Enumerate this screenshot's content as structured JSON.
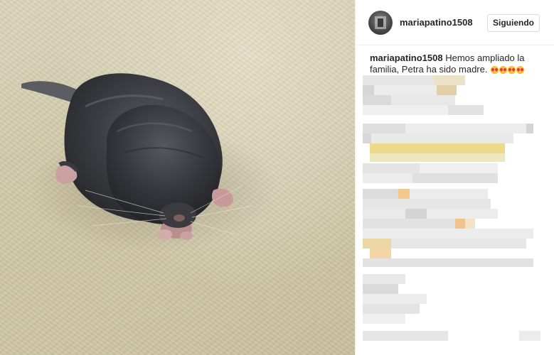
{
  "post": {
    "image_alt": "baby-chinchilla-photo",
    "author": {
      "username": "mariapatino1508",
      "follow_label": "Siguiendo"
    },
    "caption": {
      "username": "mariapatino1508",
      "text": "Hemos ampliado la familia, Petra ha sido madre.",
      "emoji": "heart-eyes-emoji",
      "emoji_count": 4
    }
  },
  "colors": {
    "pixel_gray_light": "#ececec",
    "pixel_gray_mid": "#dcdcdc",
    "pixel_gray_dark": "#c8c8c8",
    "pixel_highlight": "#ecd98a",
    "pixel_peach": "#f2c98c"
  }
}
